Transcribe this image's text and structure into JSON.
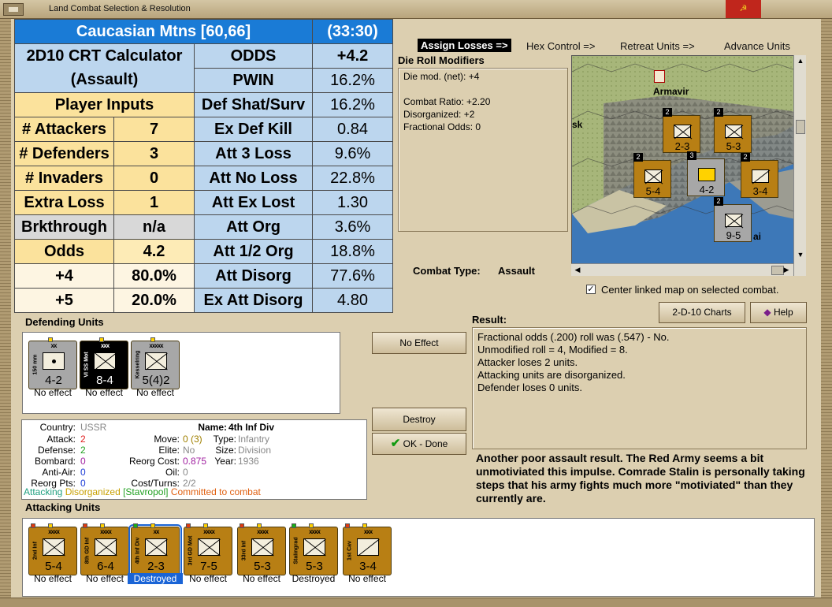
{
  "window": {
    "title": "Land Combat Selection & Resolution"
  },
  "crt": {
    "header_title": "Caucasian Mtns [60,66]",
    "header_turn": "(33:30)",
    "calc_title_1": "2D10 CRT Calculator",
    "calc_title_2": "(Assault)",
    "player_inputs": "Player Inputs",
    "inputs": [
      {
        "label": "# Attackers",
        "value": "7"
      },
      {
        "label": "# Defenders",
        "value": "3"
      },
      {
        "label": "# Invaders",
        "value": "0"
      },
      {
        "label": "Extra Loss",
        "value": "1"
      },
      {
        "label": "Brkthrough",
        "value": "n/a"
      },
      {
        "label": "Odds",
        "value": "4.2"
      },
      {
        "label": "+4",
        "value": "80.0%"
      },
      {
        "label": "+5",
        "value": "20.0%"
      }
    ],
    "results": [
      {
        "label": "ODDS",
        "value": "+4.2"
      },
      {
        "label": "PWIN",
        "value": "16.2%"
      },
      {
        "label": "Def Shat/Surv",
        "value": "16.2%"
      },
      {
        "label": "Ex Def Kill",
        "value": "0.84"
      },
      {
        "label": "Att 3 Loss",
        "value": "9.6%"
      },
      {
        "label": "Att No Loss",
        "value": "22.8%"
      },
      {
        "label": "Att Ex Lost",
        "value": "1.30"
      },
      {
        "label": "Att Org",
        "value": "3.6%"
      },
      {
        "label": "Att 1/2 Org",
        "value": "18.8%"
      },
      {
        "label": "Att Disorg",
        "value": "77.6%"
      },
      {
        "label": "Ex Att Disorg",
        "value": "4.80"
      }
    ]
  },
  "menu": {
    "assign_losses": "Assign Losses =>",
    "hex_control": "Hex Control =>",
    "retreat_units": "Retreat Units =>",
    "advance_units": "Advance Units"
  },
  "die_mods": {
    "title": "Die Roll Modifiers",
    "lines": [
      "Die mod. (net): +4",
      "",
      "Combat Ratio: +2.20",
      "Disorganized: +2",
      "Fractional Odds: 0"
    ]
  },
  "combat_type": {
    "label": "Combat Type:",
    "value": "Assault"
  },
  "map": {
    "city": "Armavir",
    "fragment_left": "sk",
    "fragment_bottom": "ai",
    "counters": [
      {
        "val": "2-3",
        "stack": "2"
      },
      {
        "val": "5-3",
        "stack": "2"
      },
      {
        "val": "5-4",
        "stack": "2"
      },
      {
        "val": "4-2",
        "stack": "3"
      },
      {
        "val": "3-4",
        "stack": "2"
      },
      {
        "val": "9-5",
        "stack": "2"
      }
    ]
  },
  "center_map": {
    "label": "Center linked map on selected combat.",
    "check": "✓"
  },
  "buttons": {
    "charts": "2-D-10 Charts",
    "help": "Help",
    "no_effect": "No Effect",
    "destroy": "Destroy",
    "ok_done": "OK - Done"
  },
  "result": {
    "title": "Result:",
    "lines": [
      "Fractional odds (.200) roll was (.547)  - No.",
      "Unmodified roll = 4, Modified = 8.",
      "Attacker loses 2 units.",
      "Attacking units are disorganized.",
      "Defender loses 0 units."
    ]
  },
  "comment": "Another poor assault result.  The Red Army seems a bit unmotiviated this impulse.  Comrade Stalin is personally taking steps that his army fights much more \"motiviated\" than they currently are.",
  "defending": {
    "title": "Defending Units",
    "units": [
      {
        "side": "150 mm",
        "size": "xx",
        "val": "4-2",
        "status": "No effect"
      },
      {
        "side": "VI SS Mot",
        "size": "xxx",
        "val": "8-4",
        "status": "No effect"
      },
      {
        "side": "Kesselring",
        "size": "xxxxx",
        "val": "5(4)2",
        "status": "No effect"
      }
    ]
  },
  "info": {
    "country_lbl": "Country:",
    "country": "USSR",
    "attack_lbl": "Attack:",
    "attack": "2",
    "defense_lbl": "Defense:",
    "defense": "2",
    "bombard_lbl": "Bombard:",
    "bombard": "0",
    "antiair_lbl": "Anti-Air:",
    "antiair": "0",
    "reorgpts_lbl": "Reorg Pts:",
    "reorgpts": "0",
    "name_lbl": "Name:",
    "name": "4th Inf Div",
    "move_lbl": "Move:",
    "move": "0 (3)",
    "type_lbl": "Type:",
    "type": "Infantry",
    "elite_lbl": "Elite:",
    "elite": "No",
    "size_lbl": "Size:",
    "size": "Division",
    "reorgcost_lbl": "Reorg Cost:",
    "reorgcost": "0.875",
    "year_lbl": "Year:",
    "year": "1936",
    "oil_lbl": "Oil:",
    "oil": "0",
    "costturns_lbl": "Cost/Turns:",
    "costturns": "2/2",
    "status_attacking": "Attacking",
    "status_disorganized": "Disorganized",
    "status_location": "[Stavropol]",
    "status_committed": "Committed to combat"
  },
  "attacking": {
    "title": "Attacking Units",
    "units": [
      {
        "side": "2nd Inf",
        "size": "xxxx",
        "val": "5-4",
        "status": "No effect"
      },
      {
        "side": "8th GD Inf",
        "size": "xxxx",
        "val": "6-4",
        "status": "No effect"
      },
      {
        "side": "4th Inf Div",
        "size": "xx",
        "val": "2-3",
        "status": "Destroyed"
      },
      {
        "side": "3rd GD Mot",
        "size": "xxxx",
        "val": "7-5",
        "status": "No effect"
      },
      {
        "side": "33rd Inf",
        "size": "xxxx",
        "val": "5-3",
        "status": "No effect"
      },
      {
        "side": "Stalingrad",
        "size": "xxxx",
        "val": "5-3",
        "status": "Destroyed"
      },
      {
        "side": "1st Cav",
        "size": "xxx",
        "val": "3-4",
        "status": "No effect"
      }
    ]
  },
  "colors": {
    "accent": "#1a7bd6",
    "attack_red": "#e02020",
    "defense_green": "#20a020",
    "zero_blue": "#1a3ad6",
    "reorg_purple": "#a020a0"
  }
}
